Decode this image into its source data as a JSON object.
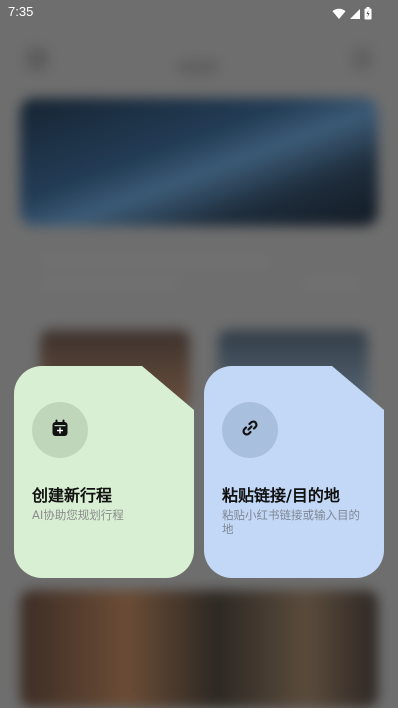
{
  "status_bar": {
    "time": "7:35",
    "icons": [
      "wifi-icon",
      "signal-icon",
      "battery-icon"
    ]
  },
  "actions": {
    "create": {
      "title": "创建新行程",
      "description": "AI协助您规划行程",
      "icon": "calendar-add-icon",
      "background": "#d8efd3"
    },
    "paste": {
      "title": "粘贴链接/目的地",
      "description": "粘贴小红书链接或输入目的地",
      "icon": "link-icon",
      "background": "#c3d8f6"
    }
  }
}
